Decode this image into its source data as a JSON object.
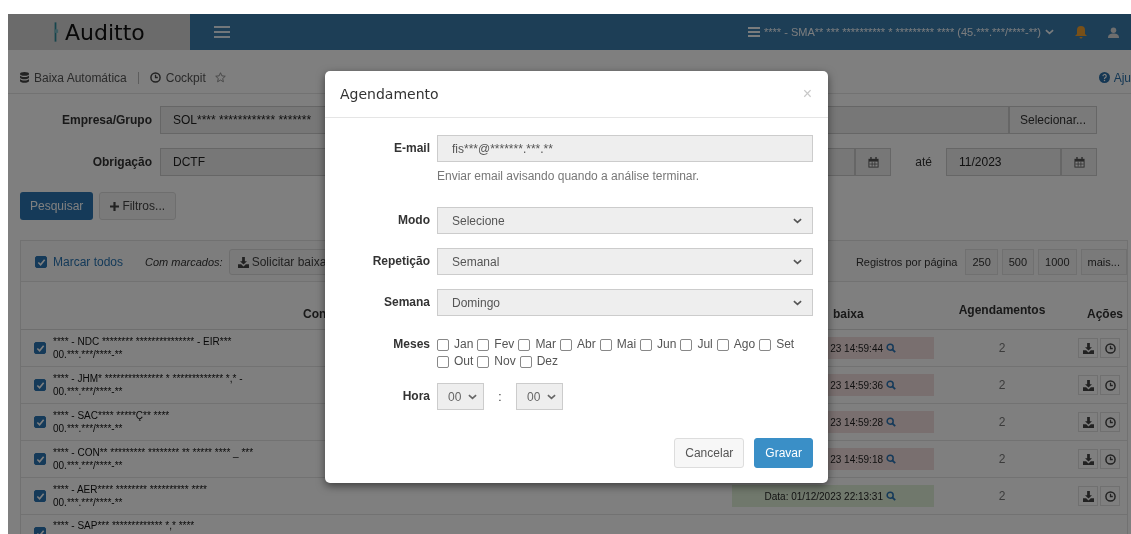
{
  "app": {
    "logo": "Auditto",
    "company_selector": "**** - SMA** *** ********** * ********* **** (45.***.***/****-**)"
  },
  "breadcrumb": [
    {
      "label": "Baixa Automática"
    },
    {
      "label": "Cockpit"
    }
  ],
  "help_link": "Aju",
  "filters": {
    "company": {
      "label": "Empresa/Grupo",
      "value": "SOL**** ************ *******",
      "button": "Selecionar..."
    },
    "obligation": {
      "label": "Obrigação",
      "value": "DCTF",
      "to_label": "até",
      "to_value": "11/2023"
    }
  },
  "actions": {
    "search": "Pesquisar",
    "filters": "Filtros..."
  },
  "toolbar": {
    "select_all": {
      "label": "Marcar todos",
      "checked": true
    },
    "with_selected": "Com marcados:",
    "request_button": "Solicitar baixa",
    "per_page_label": "Registros por página",
    "per_page_options": [
      "250",
      "500",
      "1000",
      "mais..."
    ]
  },
  "table": {
    "columns": [
      "Con",
      "baixa",
      "Agendamentos",
      "Ações"
    ],
    "rows": [
      {
        "checked": true,
        "name": "**** - NDC ******** *************** - EIR***",
        "cnpj": "00.***.***/****-**",
        "date": "23 14:59:44",
        "color": "#796f6f",
        "schedules": "2"
      },
      {
        "checked": true,
        "name": "**** - JHM* *************** * ************* *,* -",
        "cnpj": "00.***.***/****-**",
        "date": "23 14:59:36",
        "color": "#796f6f",
        "schedules": "2"
      },
      {
        "checked": true,
        "name": "**** - SAC**** *****Ç** ****",
        "cnpj": "00.***.***/****-**",
        "date": "23 14:59:28",
        "color": "#796f6f",
        "schedules": "2"
      },
      {
        "checked": true,
        "name": "**** - CON** ********* ******** ** ***** **** _ ***",
        "cnpj": "00.***.***/****-**",
        "date": "23 14:59:18",
        "color": "#796f6f",
        "schedules": "2"
      },
      {
        "checked": true,
        "name": "**** - AER**** ******** ********** ****",
        "cnpj": "00.***.***/****-**",
        "date": "Data: 01/12/2023 22:13:31",
        "color": "#70786c",
        "schedules": "2"
      },
      {
        "checked": true,
        "name": "**** - SAP*** ************* *,* ****"
      }
    ]
  },
  "modal": {
    "title": "Agendamento",
    "close": "×",
    "fields": [
      {
        "kind": "input",
        "label": "E-mail",
        "value": "fis***@*******.***.**",
        "help": "Enviar email avisando quando a análise terminar."
      },
      {
        "kind": "select",
        "label": "Modo",
        "value": "Selecione"
      },
      {
        "kind": "select",
        "label": "Repetição",
        "value": "Semanal"
      },
      {
        "kind": "select",
        "label": "Semana",
        "value": "Domingo"
      },
      {
        "kind": "checkboxes",
        "label": "Meses",
        "options": [
          {
            "label": "Jan",
            "checked": false
          },
          {
            "label": "Fev",
            "checked": false
          },
          {
            "label": "Mar",
            "checked": false
          },
          {
            "label": "Abr",
            "checked": false
          },
          {
            "label": "Mai",
            "checked": false
          },
          {
            "label": "Jun",
            "checked": false
          },
          {
            "label": "Jul",
            "checked": false
          },
          {
            "label": "Ago",
            "checked": false
          },
          {
            "label": "Set",
            "checked": false
          },
          {
            "label": "Out",
            "checked": false
          },
          {
            "label": "Nov",
            "checked": false
          },
          {
            "label": "Dez",
            "checked": false
          }
        ]
      },
      {
        "kind": "time",
        "label": "Hora",
        "hour": "00",
        "separator": ":",
        "minute": "00"
      }
    ],
    "buttons": [
      {
        "label": "Cancelar",
        "kind": "default"
      },
      {
        "label": "Gravar",
        "kind": "primary"
      }
    ]
  }
}
